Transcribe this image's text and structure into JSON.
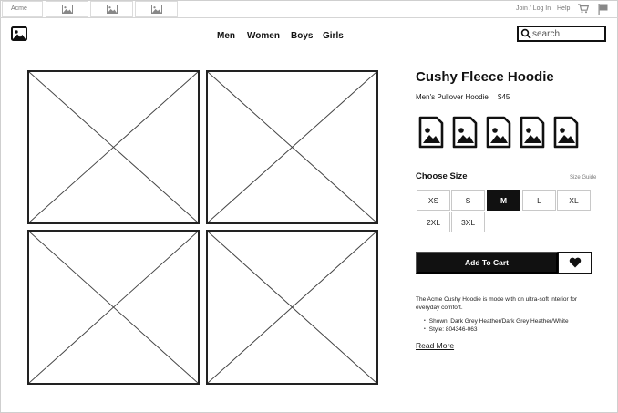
{
  "topbar": {
    "brand": "Acme",
    "image_tabs": [
      "image-icon",
      "image-icon",
      "image-icon"
    ],
    "login": "Join / Log In",
    "help": "Help",
    "cart_icon": "cart-icon",
    "flag_icon": "flag-icon"
  },
  "header": {
    "logo_icon": "image-icon",
    "nav": [
      "Men",
      "Women",
      "Boys",
      "Girls"
    ],
    "search": {
      "placeholder": "search",
      "value": ""
    }
  },
  "gallery": {
    "images": [
      "placeholder",
      "placeholder",
      "placeholder",
      "placeholder"
    ]
  },
  "product": {
    "title": "Cushy Fleece Hoodie",
    "subtitle": "Men's Pullover Hoodie",
    "price": "$45",
    "color_swatches": [
      "image-icon",
      "image-icon",
      "image-icon",
      "image-icon",
      "image-icon"
    ],
    "size_heading": "Choose Size",
    "size_guide": "Size Guide",
    "sizes": [
      "XS",
      "S",
      "M",
      "L",
      "XL",
      "2XL",
      "3XL"
    ],
    "selected_size": "M",
    "add_to_cart": "Add To Cart",
    "wishlist_icon": "heart-icon",
    "description": "The Acme Cushy Hoodie is mode with on ultra-soft interior for everyday comfort.",
    "details": [
      "Shown: Dark Grey Heather/Dark Grey Heather/White",
      "Style: 804346-063"
    ],
    "read_more": "Read More"
  },
  "colors": {
    "ink": "#111111",
    "selected_bg": "#111111",
    "border": "#c8c8c8",
    "muted": "#777777"
  }
}
